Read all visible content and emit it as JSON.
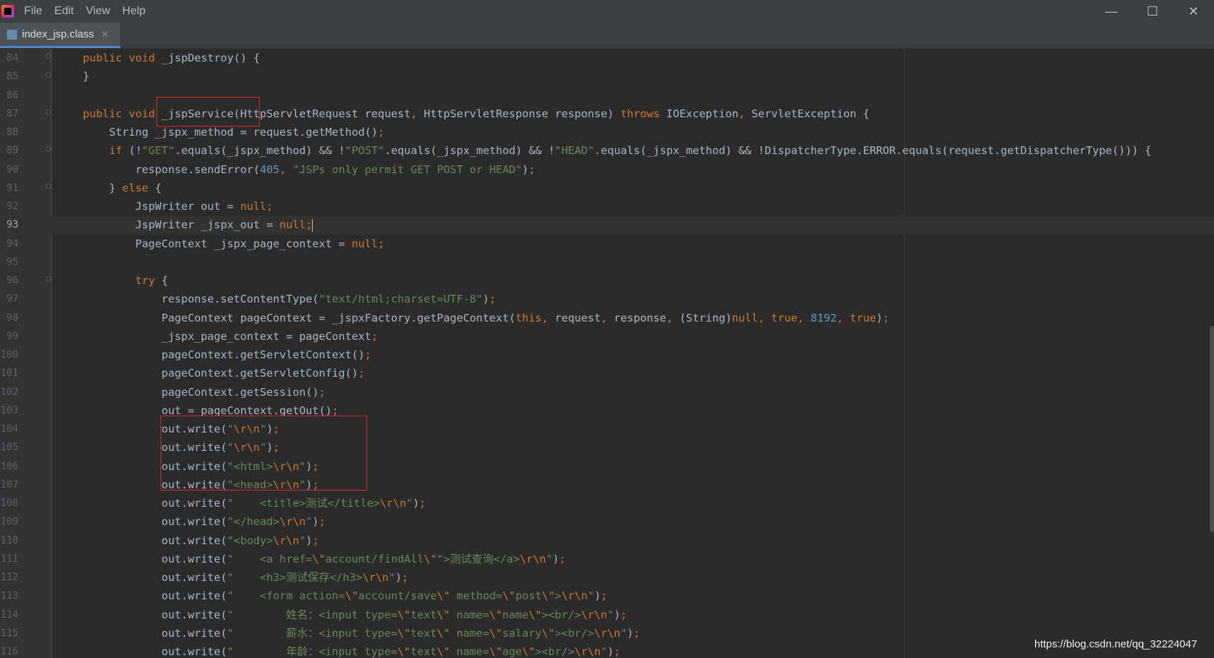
{
  "window": {
    "menu": [
      "File",
      "Edit",
      "View",
      "Help"
    ],
    "controls": {
      "minimize": "—",
      "maximize": "☐",
      "close": "✕"
    }
  },
  "tab": {
    "label": "index_jsp.class",
    "close": "✕"
  },
  "editor": {
    "current_line": 93,
    "lines": [
      {
        "n": "84",
        "fold": true,
        "tokens": [
          [
            "    ",
            ""
          ],
          [
            "public void ",
            "kw"
          ],
          [
            "_jspDestroy() {",
            ""
          ]
        ]
      },
      {
        "n": "85",
        "fold": true,
        "tokens": [
          [
            "    }",
            ""
          ]
        ]
      },
      {
        "n": "86",
        "fold": false,
        "tokens": []
      },
      {
        "n": "87",
        "fold": true,
        "tokens": [
          [
            "    ",
            ""
          ],
          [
            "public void ",
            "kw"
          ],
          [
            "_jspService(HttpServletRequest request",
            ""
          ],
          [
            ", ",
            "kw"
          ],
          [
            "HttpServletResponse response) ",
            ""
          ],
          [
            "throws ",
            "kw"
          ],
          [
            "IOException",
            ""
          ],
          [
            ", ",
            "kw"
          ],
          [
            "ServletException {",
            ""
          ]
        ]
      },
      {
        "n": "88",
        "fold": false,
        "tokens": [
          [
            "        String _jspx_method = request.getMethod()",
            ""
          ],
          [
            ";",
            "kw"
          ]
        ]
      },
      {
        "n": "89",
        "fold": true,
        "tokens": [
          [
            "        ",
            ""
          ],
          [
            "if ",
            "kw"
          ],
          [
            "(!",
            ""
          ],
          [
            "\"GET\"",
            "str"
          ],
          [
            ".equals(_jspx_method) && !",
            ""
          ],
          [
            "\"POST\"",
            "str"
          ],
          [
            ".equals(_jspx_method) && !",
            ""
          ],
          [
            "\"HEAD\"",
            "str"
          ],
          [
            ".equals(_jspx_method) && !DispatcherType.ERROR.equals(request.getDispatcherType())) {",
            ""
          ]
        ]
      },
      {
        "n": "90",
        "fold": false,
        "tokens": [
          [
            "            response.sendError(",
            ""
          ],
          [
            "405",
            "num"
          ],
          [
            ", ",
            "kw"
          ],
          [
            "\"JSPs only permit GET POST or HEAD\"",
            "str"
          ],
          [
            ")",
            ""
          ],
          [
            ";",
            "kw"
          ]
        ]
      },
      {
        "n": "91",
        "fold": true,
        "tokens": [
          [
            "        } ",
            ""
          ],
          [
            "else ",
            "kw"
          ],
          [
            "{",
            ""
          ]
        ]
      },
      {
        "n": "92",
        "fold": false,
        "tokens": [
          [
            "            JspWriter out = ",
            ""
          ],
          [
            "null",
            "kw"
          ],
          [
            ";",
            "kw"
          ]
        ]
      },
      {
        "n": "93",
        "fold": false,
        "tokens": [
          [
            "            JspWriter _jspx_out = ",
            ""
          ],
          [
            "null",
            "kw"
          ],
          [
            ";",
            "kw"
          ]
        ]
      },
      {
        "n": "94",
        "fold": false,
        "tokens": [
          [
            "            PageContext _jspx_page_context = ",
            ""
          ],
          [
            "null",
            "kw"
          ],
          [
            ";",
            "kw"
          ]
        ]
      },
      {
        "n": "95",
        "fold": false,
        "tokens": []
      },
      {
        "n": "96",
        "fold": true,
        "tokens": [
          [
            "            ",
            ""
          ],
          [
            "try ",
            "kw"
          ],
          [
            "{",
            ""
          ]
        ]
      },
      {
        "n": "97",
        "fold": false,
        "tokens": [
          [
            "                response.setContentType(",
            ""
          ],
          [
            "\"text/html;charset=UTF-8\"",
            "str"
          ],
          [
            ")",
            ""
          ],
          [
            ";",
            "kw"
          ]
        ]
      },
      {
        "n": "98",
        "fold": false,
        "tokens": [
          [
            "                PageContext pageContext = _jspxFactory.getPageContext(",
            ""
          ],
          [
            "this",
            "kw"
          ],
          [
            ", ",
            "kw"
          ],
          [
            "request",
            ""
          ],
          [
            ", ",
            "kw"
          ],
          [
            "response",
            ""
          ],
          [
            ", ",
            "kw"
          ],
          [
            "(String)",
            ""
          ],
          [
            "null",
            "kw"
          ],
          [
            ", ",
            "kw"
          ],
          [
            "true",
            "kw"
          ],
          [
            ", ",
            "kw"
          ],
          [
            "8192",
            "num"
          ],
          [
            ", ",
            "kw"
          ],
          [
            "true",
            "kw"
          ],
          [
            ")",
            ""
          ],
          [
            ";",
            "kw"
          ]
        ]
      },
      {
        "n": "99",
        "fold": false,
        "tokens": [
          [
            "                _jspx_page_context = pageContext",
            ""
          ],
          [
            ";",
            "kw"
          ]
        ]
      },
      {
        "n": "100",
        "fold": false,
        "tokens": [
          [
            "                pageContext.getServletContext()",
            ""
          ],
          [
            ";",
            "kw"
          ]
        ]
      },
      {
        "n": "101",
        "fold": false,
        "tokens": [
          [
            "                pageContext.getServletConfig()",
            ""
          ],
          [
            ";",
            "kw"
          ]
        ]
      },
      {
        "n": "102",
        "fold": false,
        "tokens": [
          [
            "                pageContext.getSession()",
            ""
          ],
          [
            ";",
            "kw"
          ]
        ]
      },
      {
        "n": "103",
        "fold": false,
        "tokens": [
          [
            "                out = pageContext.getOut()",
            ""
          ],
          [
            ";",
            "kw"
          ]
        ]
      },
      {
        "n": "104",
        "fold": false,
        "tokens": [
          [
            "                out.write(",
            ""
          ],
          [
            "\"",
            "str"
          ],
          [
            "\\r\\n",
            "esc"
          ],
          [
            "\"",
            "str"
          ],
          [
            ")",
            ""
          ],
          [
            ";",
            "kw"
          ]
        ]
      },
      {
        "n": "105",
        "fold": false,
        "tokens": [
          [
            "                out.write(",
            ""
          ],
          [
            "\"",
            "str"
          ],
          [
            "\\r\\n",
            "esc"
          ],
          [
            "\"",
            "str"
          ],
          [
            ")",
            ""
          ],
          [
            ";",
            "kw"
          ]
        ]
      },
      {
        "n": "106",
        "fold": false,
        "tokens": [
          [
            "                out.write(",
            ""
          ],
          [
            "\"<html>",
            "str"
          ],
          [
            "\\r\\n",
            "esc"
          ],
          [
            "\"",
            "str"
          ],
          [
            ")",
            ""
          ],
          [
            ";",
            "kw"
          ]
        ]
      },
      {
        "n": "107",
        "fold": false,
        "tokens": [
          [
            "                out.write(",
            ""
          ],
          [
            "\"<head>",
            "str"
          ],
          [
            "\\r\\n",
            "esc"
          ],
          [
            "\"",
            "str"
          ],
          [
            ")",
            ""
          ],
          [
            ";",
            "kw"
          ]
        ]
      },
      {
        "n": "108",
        "fold": false,
        "tokens": [
          [
            "                out.write(",
            ""
          ],
          [
            "\"    <title>测试</title>",
            "str"
          ],
          [
            "\\r\\n",
            "esc"
          ],
          [
            "\"",
            "str"
          ],
          [
            ")",
            ""
          ],
          [
            ";",
            "kw"
          ]
        ]
      },
      {
        "n": "109",
        "fold": false,
        "tokens": [
          [
            "                out.write(",
            ""
          ],
          [
            "\"</head>",
            "str"
          ],
          [
            "\\r\\n",
            "esc"
          ],
          [
            "\"",
            "str"
          ],
          [
            ")",
            ""
          ],
          [
            ";",
            "kw"
          ]
        ]
      },
      {
        "n": "110",
        "fold": false,
        "tokens": [
          [
            "                out.write(",
            ""
          ],
          [
            "\"<body>",
            "str"
          ],
          [
            "\\r\\n",
            "esc"
          ],
          [
            "\"",
            "str"
          ],
          [
            ")",
            ""
          ],
          [
            ";",
            "kw"
          ]
        ]
      },
      {
        "n": "111",
        "fold": false,
        "tokens": [
          [
            "                out.write(",
            ""
          ],
          [
            "\"    <a href=",
            "str"
          ],
          [
            "\\\"",
            "esc"
          ],
          [
            "account/findAll",
            "str"
          ],
          [
            "\\\"",
            "esc"
          ],
          [
            "\">测试查询</a>",
            "str"
          ],
          [
            "\\r\\n",
            "esc"
          ],
          [
            "\"",
            "str"
          ],
          [
            ")",
            ""
          ],
          [
            ";",
            "kw"
          ]
        ]
      },
      {
        "n": "112",
        "fold": false,
        "tokens": [
          [
            "                out.write(",
            ""
          ],
          [
            "\"    <h3>测试保存</h3>",
            "str"
          ],
          [
            "\\r\\n",
            "esc"
          ],
          [
            "\"",
            "str"
          ],
          [
            ")",
            ""
          ],
          [
            ";",
            "kw"
          ]
        ]
      },
      {
        "n": "113",
        "fold": false,
        "tokens": [
          [
            "                out.write(",
            ""
          ],
          [
            "\"    <form action=",
            "str"
          ],
          [
            "\\\"",
            "esc"
          ],
          [
            "account/save",
            "str"
          ],
          [
            "\\\"",
            "esc"
          ],
          [
            " method=",
            "str"
          ],
          [
            "\\\"",
            "esc"
          ],
          [
            "post",
            "str"
          ],
          [
            "\\\"",
            "esc"
          ],
          [
            ">",
            "str"
          ],
          [
            "\\r\\n",
            "esc"
          ],
          [
            "\"",
            "str"
          ],
          [
            ")",
            ""
          ],
          [
            ";",
            "kw"
          ]
        ]
      },
      {
        "n": "114",
        "fold": false,
        "tokens": [
          [
            "                out.write(",
            ""
          ],
          [
            "\"        姓名：<input type=",
            "str"
          ],
          [
            "\\\"",
            "esc"
          ],
          [
            "text",
            "str"
          ],
          [
            "\\\"",
            "esc"
          ],
          [
            " name=",
            "str"
          ],
          [
            "\\\"",
            "esc"
          ],
          [
            "name",
            "str"
          ],
          [
            "\\\"",
            "esc"
          ],
          [
            "><br/>",
            "str"
          ],
          [
            "\\r\\n",
            "esc"
          ],
          [
            "\"",
            "str"
          ],
          [
            ")",
            ""
          ],
          [
            ";",
            "kw"
          ]
        ]
      },
      {
        "n": "115",
        "fold": false,
        "tokens": [
          [
            "                out.write(",
            ""
          ],
          [
            "\"        薪水：<input type=",
            "str"
          ],
          [
            "\\\"",
            "esc"
          ],
          [
            "text",
            "str"
          ],
          [
            "\\\"",
            "esc"
          ],
          [
            " name=",
            "str"
          ],
          [
            "\\\"",
            "esc"
          ],
          [
            "salary",
            "str"
          ],
          [
            "\\\"",
            "esc"
          ],
          [
            "><br/>",
            "str"
          ],
          [
            "\\r\\n",
            "esc"
          ],
          [
            "\"",
            "str"
          ],
          [
            ")",
            ""
          ],
          [
            ";",
            "kw"
          ]
        ]
      },
      {
        "n": "116",
        "fold": false,
        "tokens": [
          [
            "                out.write(",
            ""
          ],
          [
            "\"        年龄：<input type=",
            "str"
          ],
          [
            "\\\"",
            "esc"
          ],
          [
            "text",
            "str"
          ],
          [
            "\\\"",
            "esc"
          ],
          [
            " name=",
            "str"
          ],
          [
            "\\\"",
            "esc"
          ],
          [
            "age",
            "str"
          ],
          [
            "\\\"",
            "esc"
          ],
          [
            "><br/>",
            "str"
          ],
          [
            "\\r\\n",
            "esc"
          ],
          [
            "\"",
            "str"
          ],
          [
            ")",
            ""
          ],
          [
            ";",
            "kw"
          ]
        ]
      }
    ]
  },
  "watermark": "https://blog.csdn.net/qq_32224047",
  "colors": {
    "background": "#2b2b2b",
    "keyword": "#cc7832",
    "string": "#6a8759",
    "number": "#6897bb",
    "text": "#a9b7c6",
    "highlight_box": "#e0292a"
  }
}
